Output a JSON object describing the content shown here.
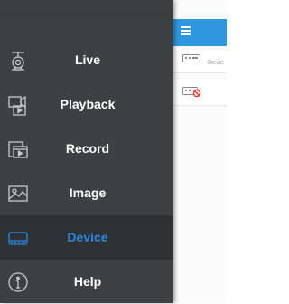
{
  "drawer": {
    "items": [
      {
        "label": "Live",
        "icon": "camera-icon",
        "active": false
      },
      {
        "label": "Playback",
        "icon": "playback-icon",
        "active": false
      },
      {
        "label": "Record",
        "icon": "record-icon",
        "active": false
      },
      {
        "label": "Image",
        "icon": "image-icon",
        "active": false
      },
      {
        "label": "Device",
        "icon": "device-icon",
        "active": true
      },
      {
        "label": "Help",
        "icon": "help-icon",
        "active": false
      }
    ]
  },
  "app": {
    "header_icon": "hamburger-menu-icon",
    "rows": [
      {
        "text": "Devic",
        "icon": "dvr-device-icon"
      },
      {
        "text": "",
        "icon": "dvr-offline-icon"
      }
    ]
  },
  "colors": {
    "drawer_bg": "#3d4144",
    "active_bg": "#2f3235",
    "active_text": "#2a86e0",
    "header_bg": "#2e97e0"
  }
}
